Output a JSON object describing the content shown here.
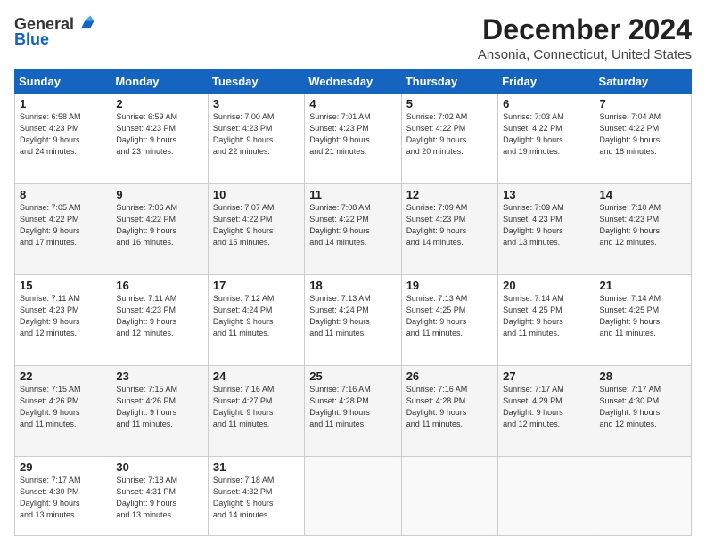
{
  "logo": {
    "general": "General",
    "blue": "Blue"
  },
  "title": "December 2024",
  "subtitle": "Ansonia, Connecticut, United States",
  "days": [
    "Sunday",
    "Monday",
    "Tuesday",
    "Wednesday",
    "Thursday",
    "Friday",
    "Saturday"
  ],
  "weeks": [
    [
      {
        "num": "1",
        "info": "Sunrise: 6:58 AM\nSunset: 4:23 PM\nDaylight: 9 hours\nand 24 minutes."
      },
      {
        "num": "2",
        "info": "Sunrise: 6:59 AM\nSunset: 4:23 PM\nDaylight: 9 hours\nand 23 minutes."
      },
      {
        "num": "3",
        "info": "Sunrise: 7:00 AM\nSunset: 4:23 PM\nDaylight: 9 hours\nand 22 minutes."
      },
      {
        "num": "4",
        "info": "Sunrise: 7:01 AM\nSunset: 4:23 PM\nDaylight: 9 hours\nand 21 minutes."
      },
      {
        "num": "5",
        "info": "Sunrise: 7:02 AM\nSunset: 4:22 PM\nDaylight: 9 hours\nand 20 minutes."
      },
      {
        "num": "6",
        "info": "Sunrise: 7:03 AM\nSunset: 4:22 PM\nDaylight: 9 hours\nand 19 minutes."
      },
      {
        "num": "7",
        "info": "Sunrise: 7:04 AM\nSunset: 4:22 PM\nDaylight: 9 hours\nand 18 minutes."
      }
    ],
    [
      {
        "num": "8",
        "info": "Sunrise: 7:05 AM\nSunset: 4:22 PM\nDaylight: 9 hours\nand 17 minutes."
      },
      {
        "num": "9",
        "info": "Sunrise: 7:06 AM\nSunset: 4:22 PM\nDaylight: 9 hours\nand 16 minutes."
      },
      {
        "num": "10",
        "info": "Sunrise: 7:07 AM\nSunset: 4:22 PM\nDaylight: 9 hours\nand 15 minutes."
      },
      {
        "num": "11",
        "info": "Sunrise: 7:08 AM\nSunset: 4:22 PM\nDaylight: 9 hours\nand 14 minutes."
      },
      {
        "num": "12",
        "info": "Sunrise: 7:09 AM\nSunset: 4:23 PM\nDaylight: 9 hours\nand 14 minutes."
      },
      {
        "num": "13",
        "info": "Sunrise: 7:09 AM\nSunset: 4:23 PM\nDaylight: 9 hours\nand 13 minutes."
      },
      {
        "num": "14",
        "info": "Sunrise: 7:10 AM\nSunset: 4:23 PM\nDaylight: 9 hours\nand 12 minutes."
      }
    ],
    [
      {
        "num": "15",
        "info": "Sunrise: 7:11 AM\nSunset: 4:23 PM\nDaylight: 9 hours\nand 12 minutes."
      },
      {
        "num": "16",
        "info": "Sunrise: 7:11 AM\nSunset: 4:23 PM\nDaylight: 9 hours\nand 12 minutes."
      },
      {
        "num": "17",
        "info": "Sunrise: 7:12 AM\nSunset: 4:24 PM\nDaylight: 9 hours\nand 11 minutes."
      },
      {
        "num": "18",
        "info": "Sunrise: 7:13 AM\nSunset: 4:24 PM\nDaylight: 9 hours\nand 11 minutes."
      },
      {
        "num": "19",
        "info": "Sunrise: 7:13 AM\nSunset: 4:25 PM\nDaylight: 9 hours\nand 11 minutes."
      },
      {
        "num": "20",
        "info": "Sunrise: 7:14 AM\nSunset: 4:25 PM\nDaylight: 9 hours\nand 11 minutes."
      },
      {
        "num": "21",
        "info": "Sunrise: 7:14 AM\nSunset: 4:25 PM\nDaylight: 9 hours\nand 11 minutes."
      }
    ],
    [
      {
        "num": "22",
        "info": "Sunrise: 7:15 AM\nSunset: 4:26 PM\nDaylight: 9 hours\nand 11 minutes."
      },
      {
        "num": "23",
        "info": "Sunrise: 7:15 AM\nSunset: 4:26 PM\nDaylight: 9 hours\nand 11 minutes."
      },
      {
        "num": "24",
        "info": "Sunrise: 7:16 AM\nSunset: 4:27 PM\nDaylight: 9 hours\nand 11 minutes."
      },
      {
        "num": "25",
        "info": "Sunrise: 7:16 AM\nSunset: 4:28 PM\nDaylight: 9 hours\nand 11 minutes."
      },
      {
        "num": "26",
        "info": "Sunrise: 7:16 AM\nSunset: 4:28 PM\nDaylight: 9 hours\nand 11 minutes."
      },
      {
        "num": "27",
        "info": "Sunrise: 7:17 AM\nSunset: 4:29 PM\nDaylight: 9 hours\nand 12 minutes."
      },
      {
        "num": "28",
        "info": "Sunrise: 7:17 AM\nSunset: 4:30 PM\nDaylight: 9 hours\nand 12 minutes."
      }
    ],
    [
      {
        "num": "29",
        "info": "Sunrise: 7:17 AM\nSunset: 4:30 PM\nDaylight: 9 hours\nand 13 minutes."
      },
      {
        "num": "30",
        "info": "Sunrise: 7:18 AM\nSunset: 4:31 PM\nDaylight: 9 hours\nand 13 minutes."
      },
      {
        "num": "31",
        "info": "Sunrise: 7:18 AM\nSunset: 4:32 PM\nDaylight: 9 hours\nand 14 minutes."
      },
      null,
      null,
      null,
      null
    ]
  ]
}
